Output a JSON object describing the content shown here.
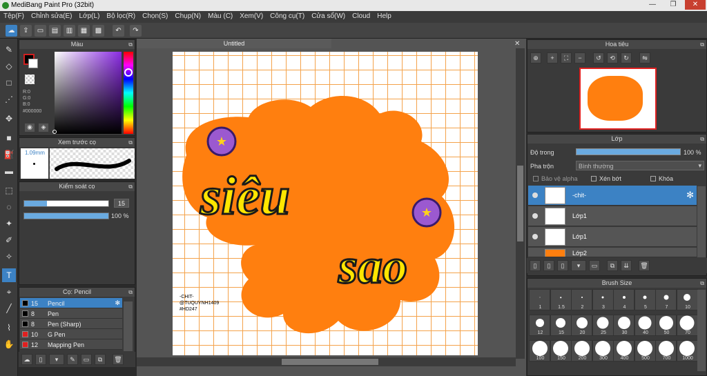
{
  "window": {
    "title": "MediBang Paint Pro (32bit)",
    "min": "—",
    "max": "❐",
    "close": "✕"
  },
  "menu": [
    "Tệp(F)",
    "Chỉnh sửa(E)",
    "Lớp(L)",
    "Bộ lọc(R)",
    "Chọn(S)",
    "Chụp(N)",
    "Màu (C)",
    "Xem(V)",
    "Công cụ(T)",
    "Cửa sổ(W)",
    "Cloud",
    "Help"
  ],
  "color_panel": {
    "title": "Màu",
    "r": "R:0",
    "g": "G:0",
    "b": "B:0",
    "hex": "#000000",
    "fg": "#000000",
    "bg": "#ffffff",
    "hue": "#8a2be2"
  },
  "brush_preview": {
    "title": "Xem trước cọ",
    "size": "1.09mm"
  },
  "brush_control": {
    "title": "Kiểm soát cọ",
    "size_value": "15",
    "opacity_value": "100 %",
    "size_fill": 0.27,
    "opacity_fill": 1.0
  },
  "brush_list": {
    "title": "Cọ: Pencil",
    "items": [
      {
        "size": "15",
        "name": "Pencil",
        "color": "#000000",
        "selected": true
      },
      {
        "size": "8",
        "name": "Pen",
        "color": "#000000"
      },
      {
        "size": "8",
        "name": "Pen (Sharp)",
        "color": "#000000"
      },
      {
        "size": "10",
        "name": "G Pen",
        "color": "#e02020"
      },
      {
        "size": "12",
        "name": "Mapping Pen",
        "color": "#e02020"
      }
    ]
  },
  "document": {
    "tab": "Untitled",
    "text_line1": "siêu",
    "text_line2": "sao",
    "signature": [
      "-CHIT-",
      "@TUQUYNH1409",
      "#HD247"
    ],
    "blob_color": "#ff7f0f",
    "text_color": "#ffe600"
  },
  "navigator": {
    "title": "Hoa tiêu"
  },
  "layers": {
    "title": "Lớp",
    "opacity_label": "Độ trong",
    "opacity_value": "100 %",
    "blend_label": "Pha trộn",
    "blend_value": "Bình thường",
    "protect_alpha": "Bảo vệ alpha",
    "clipping": "Xén bớt",
    "lock": "Khóa",
    "items": [
      {
        "name": "-chit-",
        "selected": true
      },
      {
        "name": "Lớp1"
      },
      {
        "name": "Lớp1"
      },
      {
        "name": "Lớp2"
      }
    ]
  },
  "brush_size": {
    "title": "Brush Size",
    "sizes": [
      "1",
      "1.5",
      "2",
      "3",
      "4",
      "5",
      "7",
      "10",
      "12",
      "15",
      "20",
      "25",
      "30",
      "40",
      "50",
      "70",
      "100",
      "150",
      "200",
      "300",
      "400",
      "500",
      "700",
      "1000"
    ]
  }
}
